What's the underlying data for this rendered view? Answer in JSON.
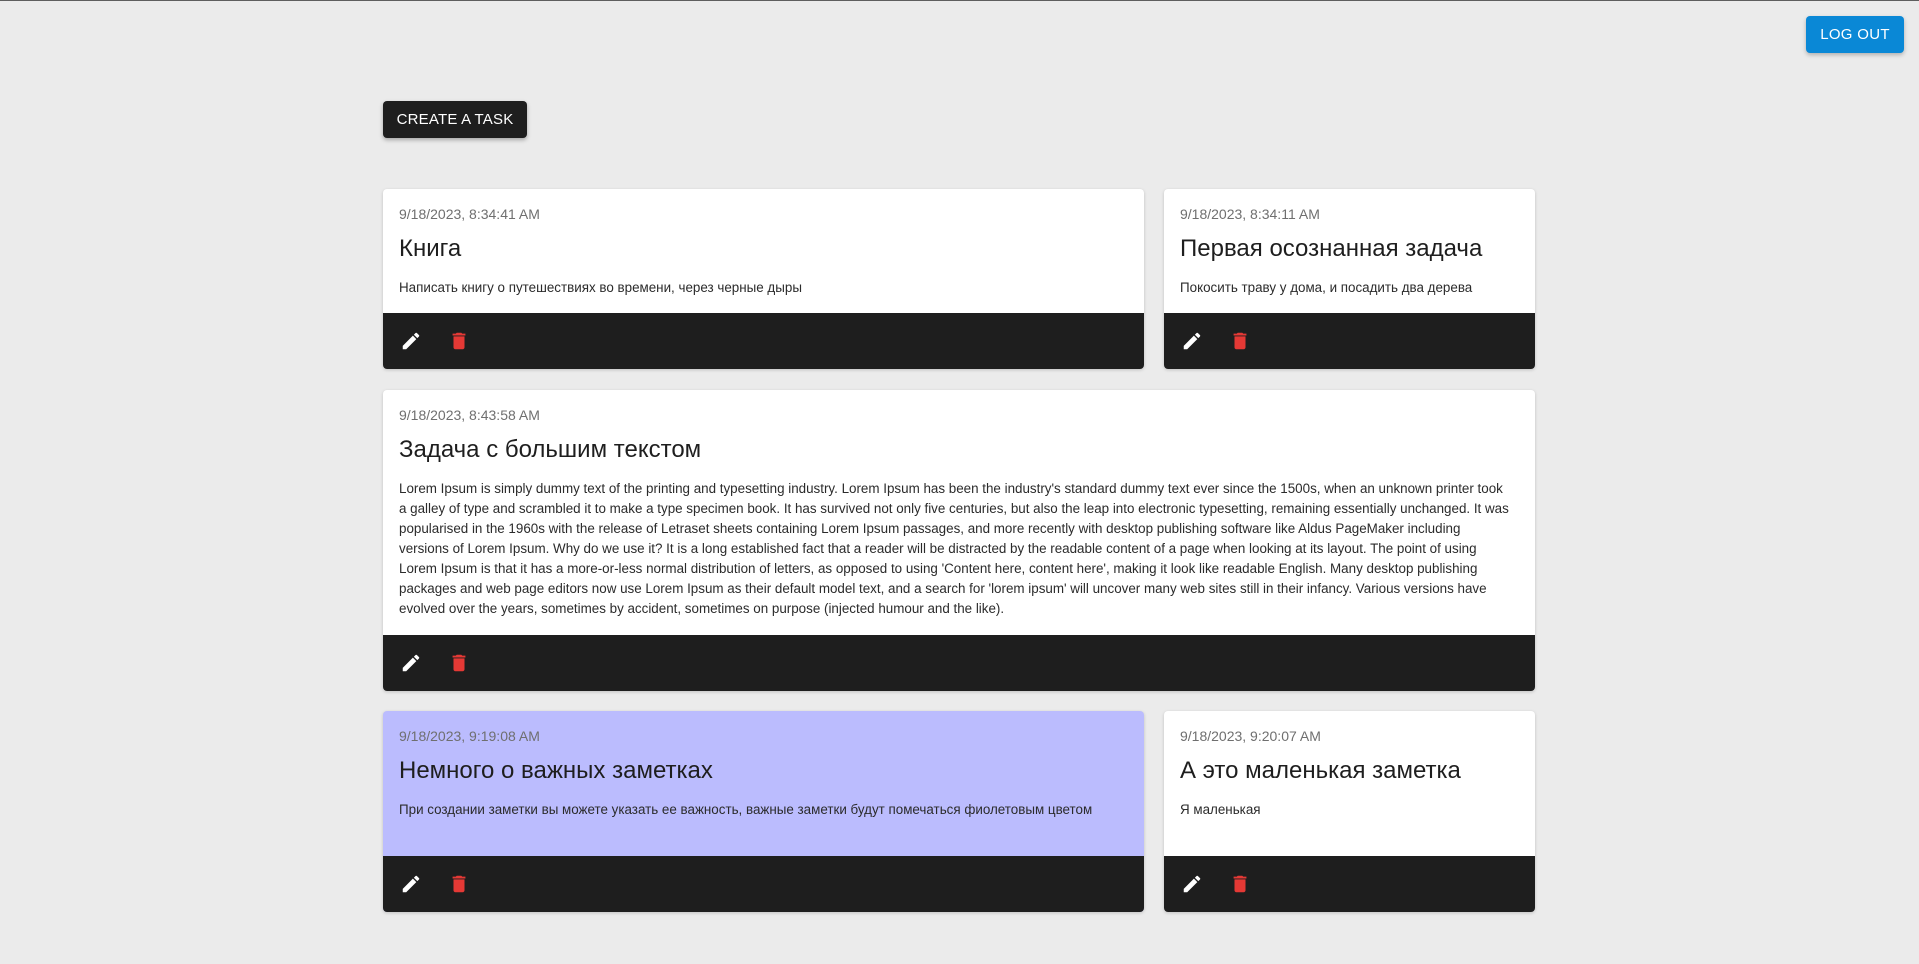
{
  "header": {
    "logout_label": "LOG OUT",
    "create_label": "CREATE A TASK"
  },
  "colors": {
    "accent": "#0a88d6",
    "dark": "#1e1e1e",
    "important": "#bbbcfe",
    "delete": "#e53935"
  },
  "tasks": [
    {
      "date": "9/18/2023, 8:34:41 AM",
      "title": "Книга",
      "text": "Написать книгу о путешествиях во времени, через черные дыры",
      "important": false
    },
    {
      "date": "9/18/2023, 8:34:11 AM",
      "title": "Первая осознанная задача",
      "text": "Покосить траву у дома, и посадить два дерева",
      "important": false
    },
    {
      "date": "9/18/2023, 8:43:58 AM",
      "title": "Задача с большим текстом",
      "text": "Lorem Ipsum is simply dummy text of the printing and typesetting industry. Lorem Ipsum has been the industry's standard dummy text ever since the 1500s, when an unknown printer took a galley of type and scrambled it to make a type specimen book. It has survived not only five centuries, but also the leap into electronic typesetting, remaining essentially unchanged. It was popularised in the 1960s with the release of Letraset sheets containing Lorem Ipsum passages, and more recently with desktop publishing software like Aldus PageMaker including versions of Lorem Ipsum. Why do we use it? It is a long established fact that a reader will be distracted by the readable content of a page when looking at its layout. The point of using Lorem Ipsum is that it has a more-or-less normal distribution of letters, as opposed to using 'Content here, content here', making it look like readable English. Many desktop publishing packages and web page editors now use Lorem Ipsum as their default model text, and a search for 'lorem ipsum' will uncover many web sites still in their infancy. Various versions have evolved over the years, sometimes by accident, sometimes on purpose (injected humour and the like).",
      "important": false
    },
    {
      "date": "9/18/2023, 9:19:08 AM",
      "title": "Немного о важных заметках",
      "text": "При создании заметки вы можете указать ее важность, важные заметки будут помечаться фиолетовым цветом",
      "important": true
    },
    {
      "date": "9/18/2023, 9:20:07 AM",
      "title": "А это маленькая заметка",
      "text": "Я маленькая",
      "important": false
    }
  ]
}
